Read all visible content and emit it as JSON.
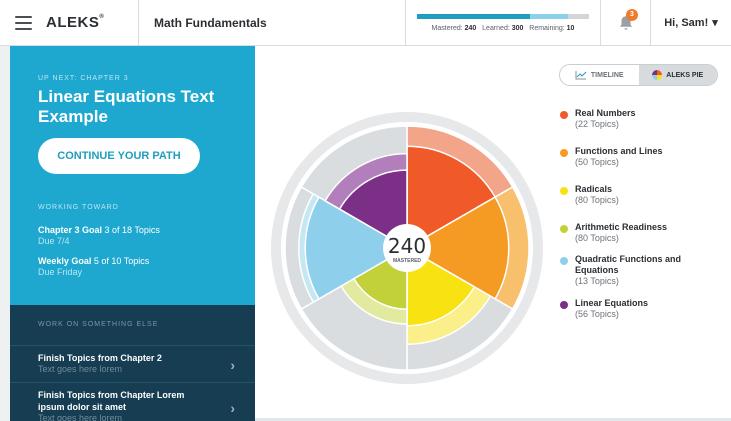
{
  "header": {
    "logo": "ALEKS",
    "logo_mark": "®",
    "course_title": "Math Fundamentals",
    "progress": {
      "mastered_label": "Mastered:",
      "mastered": "240",
      "learned_label": "Learned:",
      "learned": "300",
      "remaining_label": "Remaining:",
      "remaining": "10"
    },
    "notification_count": "3",
    "user_greeting": "Hi, Sam!",
    "user_menu_icon": "▾"
  },
  "up_next": {
    "label": "UP NEXT: CHAPTER 3",
    "title": "Linear Equations Text Example",
    "continue_label": "CONTINUE YOUR PATH"
  },
  "working_toward": {
    "label": "WORKING TOWARD",
    "goals": [
      {
        "name": "Chapter 3 Goal",
        "progress": "3 of 18 Topics",
        "due": "Due 7/4"
      },
      {
        "name": "Weekly Goal",
        "progress": "5 of 10 Topics",
        "due": "Due Friday"
      }
    ]
  },
  "work_else": {
    "label": "WORK ON SOMETHING ELSE",
    "items": [
      {
        "title": "Finish Topics from Chapter 2",
        "subtitle": "Text goes here lorem"
      },
      {
        "title": "Finish Topics from Chapter Lorem ipsum dolor sit amet",
        "subtitle": "Text goes here lorem"
      }
    ]
  },
  "view_toggle": {
    "timeline": "TIMELINE",
    "pie": "ALEKS PIE",
    "active": "pie"
  },
  "pie": {
    "center_value": "240",
    "center_label": "MASTERED",
    "slices": [
      {
        "name": "Real Numbers",
        "topics": "(22 Topics)",
        "color": "#f05a28",
        "light": "#f3a58a",
        "mastered_frac": 0.78,
        "learned_frac": 1.0
      },
      {
        "name": "Functions and Lines",
        "topics": "(50 Topics)",
        "color": "#f59a23",
        "light": "#f8bf6c",
        "mastered_frac": 0.78,
        "learned_frac": 1.0
      },
      {
        "name": "Radicals",
        "topics": "(80 Topics)",
        "color": "#f9e211",
        "light": "#fbef8a",
        "mastered_frac": 0.52,
        "learned_frac": 0.72
      },
      {
        "name": "Arithmetic Readiness",
        "topics": "(80 Topics)",
        "color": "#c2d13a",
        "light": "#e2eaa0",
        "mastered_frac": 0.34,
        "learned_frac": 0.5
      },
      {
        "name": "Quadratic Functions and Equations",
        "topics": "(13 Topics)",
        "color": "#8ed0ec",
        "light": "#c5e7f4",
        "mastered_frac": 0.78,
        "learned_frac": 0.85
      },
      {
        "name": "Linear Equations",
        "topics": "(56 Topics)",
        "color": "#7b2f86",
        "light": "#b27fbc",
        "mastered_frac": 0.52,
        "learned_frac": 0.7
      }
    ],
    "background_color": "#d9dde0",
    "ring_color": "#e6e8ea"
  }
}
